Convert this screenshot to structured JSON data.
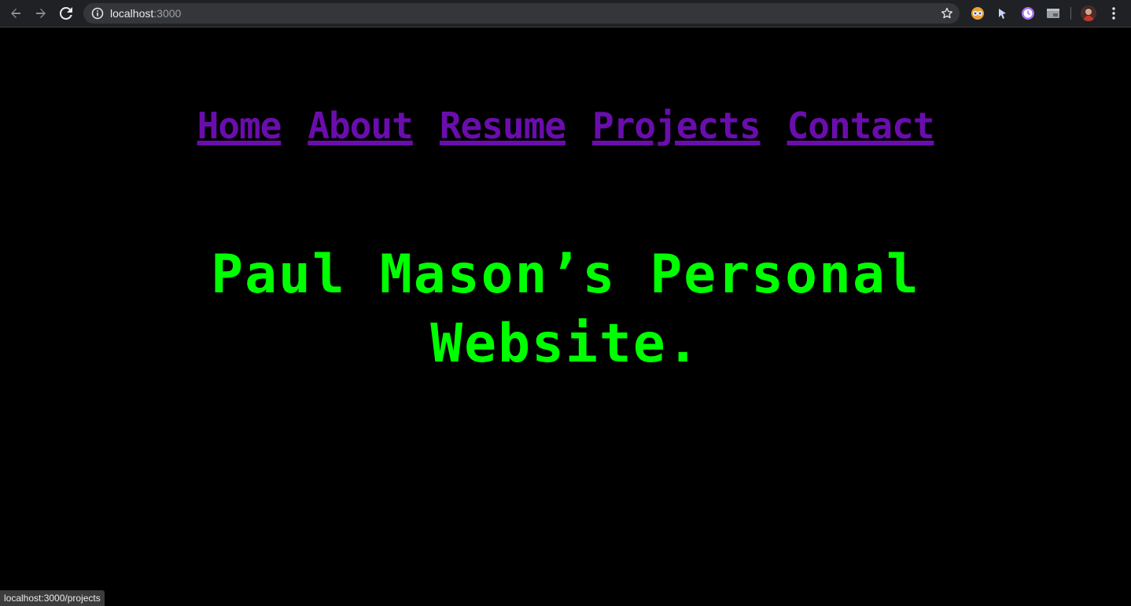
{
  "browser": {
    "url_host": "localhost",
    "url_port": ":3000",
    "status_url": "localhost:3000/projects",
    "icons": {
      "back": "arrow-left-icon",
      "forward": "arrow-right-icon",
      "reload": "reload-icon",
      "info": "info-icon",
      "bookmark": "star-icon",
      "menu": "kebab-menu-icon"
    },
    "extensions": [
      "eyes-extension-icon",
      "cursor-extension-icon",
      "clock-extension-icon",
      "tab-extension-icon"
    ]
  },
  "site": {
    "nav": [
      {
        "label": "Home"
      },
      {
        "label": "About"
      },
      {
        "label": "Resume"
      },
      {
        "label": "Projects"
      },
      {
        "label": "Contact"
      }
    ],
    "title_line1": "Paul Mason’s Personal",
    "title_line2": "Website."
  },
  "colors": {
    "background": "#000000",
    "nav_link": "#6a0dad",
    "title": "#00ff00",
    "chrome_bar": "#202124",
    "omnibox": "#35363a"
  }
}
